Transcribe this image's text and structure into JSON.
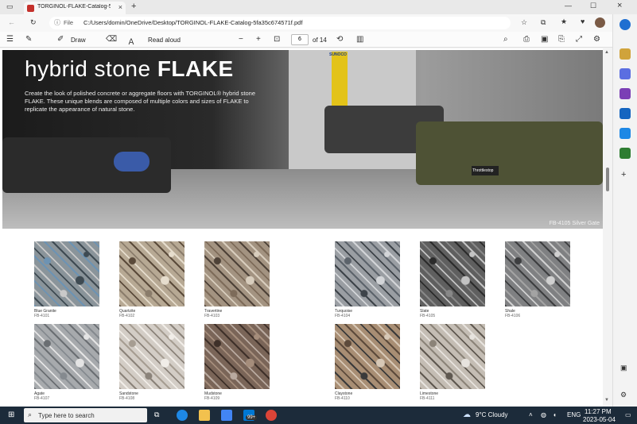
{
  "browser": {
    "tab_title": "TORGINOL-FLAKE-Catalog-5fa35",
    "address_label": "File",
    "url": "C:/Users/domin/OneDrive/Desktop/TORGINOL-FLAKE-Catalog-5fa35c674571f.pdf"
  },
  "pdf_toolbar": {
    "draw_label": "Draw",
    "read_aloud_label": "Read aloud",
    "page_current": "6",
    "page_total": "of 14"
  },
  "hero": {
    "title_light": "hybrid stone ",
    "title_bold": "FLAKE",
    "body": "Create the look of polished concrete or aggregate floors with TORGINOL® hybrid stone FLAKE. These unique blends are composed of multiple colors and sizes of FLAKE to replicate the appearance of natural stone.",
    "caption": "FB-4105 Silver Gate",
    "sign_text": "SUNOCO",
    "plate_text": "Throttlestop"
  },
  "swatches": [
    {
      "name": "Blue Granite",
      "code": "FB-4101",
      "base": "#8a949a",
      "c1": "#6d93b3",
      "c2": "#3e4a52",
      "c3": "#c9c9c9"
    },
    {
      "name": "Quartzite",
      "code": "FB-4102",
      "base": "#b7a994",
      "c1": "#5a4a3a",
      "c2": "#e6ddcd",
      "c3": "#8a7c6b"
    },
    {
      "name": "Travertine",
      "code": "FB-4103",
      "base": "#a39381",
      "c1": "#4d4137",
      "c2": "#d8cdbd",
      "c3": "#7d6b59"
    },
    {
      "name": "Turquoise",
      "code": "FB-4104",
      "base": "#9a9ea3",
      "c1": "#5c636b",
      "c2": "#d3d5d8",
      "c3": "#3d4349"
    },
    {
      "name": "Slate",
      "code": "FB-4105",
      "base": "#5f5f5f",
      "c1": "#2b2b2b",
      "c2": "#c3c3c3",
      "c3": "#888888"
    },
    {
      "name": "Shale",
      "code": "FB-4106",
      "base": "#7f8082",
      "c1": "#3d3e40",
      "c2": "#d0d0d0",
      "c3": "#a3a3a3"
    },
    {
      "name": "Agate",
      "code": "FB-4107",
      "base": "#a7aaad",
      "c1": "#6a6e72",
      "c2": "#e4e4e4",
      "c3": "#858a8f"
    },
    {
      "name": "Sandstone",
      "code": "FB-4108",
      "base": "#d3cdc6",
      "c1": "#a69d92",
      "c2": "#f1ede8",
      "c3": "#8b837a"
    },
    {
      "name": "Mudstone",
      "code": "FB-4109",
      "base": "#7a6558",
      "c1": "#3e3029",
      "c2": "#a58d7b",
      "c3": "#b9aaa0"
    },
    {
      "name": "Claystone",
      "code": "FB-4110",
      "base": "#a88e74",
      "c1": "#5c4a3b",
      "c2": "#d7c8b6",
      "c3": "#3a3a3a"
    },
    {
      "name": "Limestone",
      "code": "FB-4111",
      "base": "#c4bdb4",
      "c1": "#8b8378",
      "c2": "#e7e3de",
      "c3": "#5f5850"
    }
  ],
  "taskbar": {
    "search_placeholder": "Type here to search",
    "badge": "99+",
    "weather": "9°C  Cloudy",
    "lang": "ENG",
    "time": "11:27 PM",
    "date": "2023-05-04"
  }
}
